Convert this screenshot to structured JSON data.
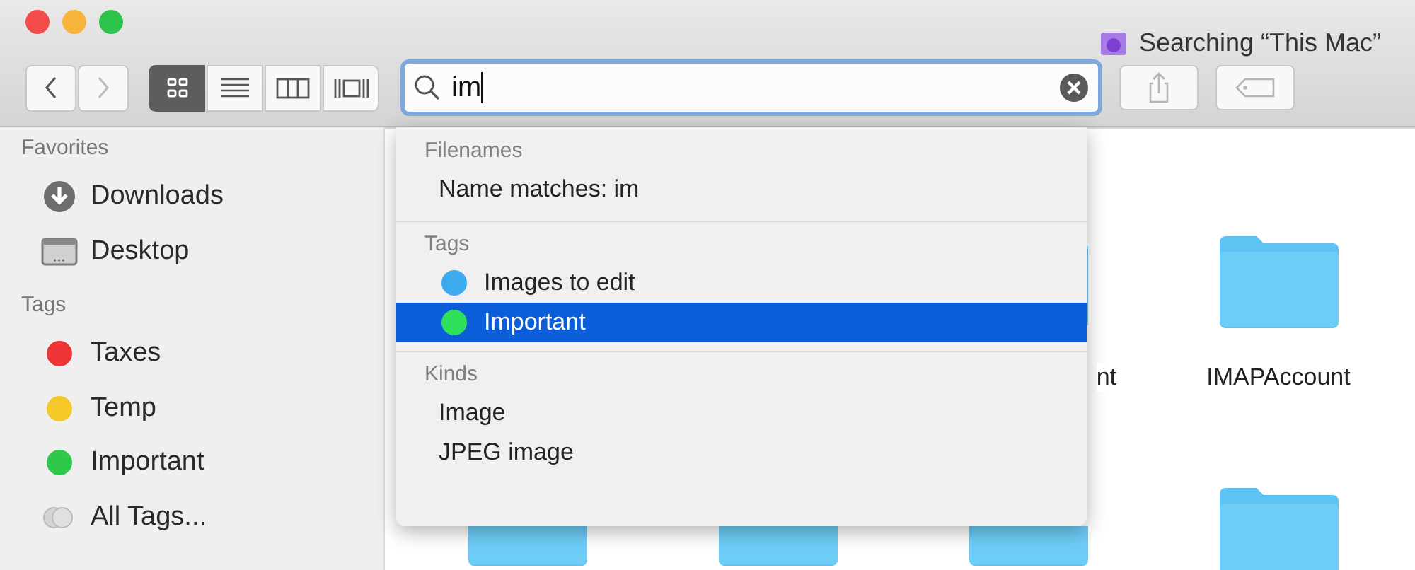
{
  "window": {
    "title": "Searching “This Mac”"
  },
  "toolbar": {
    "nav_buttons": [
      {
        "kind": "back",
        "disabled": false
      },
      {
        "kind": "forward",
        "disabled": true
      }
    ],
    "view_buttons": [
      {
        "kind": "icons",
        "selected": true
      },
      {
        "kind": "list",
        "selected": false
      },
      {
        "kind": "columns",
        "selected": false
      },
      {
        "kind": "gallery",
        "selected": false
      }
    ],
    "search": {
      "value": "im"
    },
    "action_buttons": [
      {
        "kind": "share"
      },
      {
        "kind": "tag"
      }
    ]
  },
  "sidebar": {
    "sections": [
      {
        "heading": "Favorites",
        "items": [
          {
            "label": "Downloads",
            "kind": "downloads"
          },
          {
            "label": "Desktop",
            "kind": "desktop"
          }
        ]
      },
      {
        "heading": "Tags",
        "items": [
          {
            "label": "Taxes",
            "kind": "tag",
            "color": "#ee3434"
          },
          {
            "label": "Temp",
            "kind": "tag",
            "color": "#f5c829"
          },
          {
            "label": "Important",
            "kind": "tag",
            "color": "#2ec84a"
          },
          {
            "label": "All Tags...",
            "kind": "all-tags"
          }
        ]
      }
    ]
  },
  "files": [
    {
      "kind": "folder",
      "label": "nt"
    },
    {
      "kind": "folder",
      "label": "IMAPAccount"
    },
    {
      "kind": "folder"
    },
    {
      "kind": "folder"
    },
    {
      "kind": "folder"
    },
    {
      "kind": "folder"
    }
  ],
  "suggestions": {
    "sections": [
      {
        "heading": "Filenames",
        "items": [
          {
            "label": "Name matches: im",
            "selected": false
          }
        ]
      },
      {
        "heading": "Tags",
        "items": [
          {
            "label": "Images to edit",
            "color": "#3eaaf0",
            "selected": false
          },
          {
            "label": "Important",
            "color": "#2ee05a",
            "selected": true
          }
        ]
      },
      {
        "heading": "Kinds",
        "items": [
          {
            "label": "Image",
            "selected": false
          },
          {
            "label": "JPEG image",
            "selected": false
          }
        ]
      }
    ]
  }
}
